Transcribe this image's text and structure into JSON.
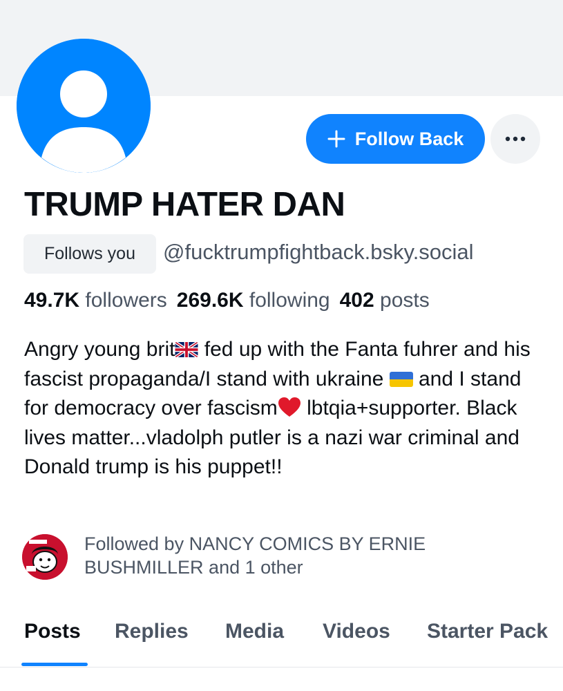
{
  "profile": {
    "display_name": "TRUMP HATER DAN",
    "follows_you_label": "Follows you",
    "handle": "@fucktrumpfightback.bsky.social",
    "avatar_icon": "default-user-avatar-icon",
    "accent_color": "#1083fe"
  },
  "actions": {
    "follow_back_label": "Follow Back",
    "follow_icon": "plus-icon",
    "more_icon": "ellipsis-icon"
  },
  "stats": {
    "followers_count": "49.7K",
    "followers_label": "followers",
    "following_count": "269.6K",
    "following_label": "following",
    "posts_count": "402",
    "posts_label": "posts"
  },
  "bio": {
    "part1": "Angry young brit",
    "flag1_icon": "uk-flag-icon",
    "part2": " fed up with the Fanta fuhrer and his fascist propaganda/I stand with ukraine ",
    "flag2_icon": "ukraine-flag-icon",
    "part3": " and I stand for democracy over fascism",
    "heart_icon": "red-heart-icon",
    "part4": " lbtqia+supporter. Black lives matter...vladolph putler is a nazi war criminal and Donald trump is his puppet!!"
  },
  "followed_by": {
    "text": "Followed by NANCY COMICS BY ERNIE BUSHMILLER and 1 other",
    "avatar_icon": "nancy-comics-avatar"
  },
  "tabs": [
    {
      "label": "Posts",
      "active": true
    },
    {
      "label": "Replies",
      "active": false
    },
    {
      "label": "Media",
      "active": false
    },
    {
      "label": "Videos",
      "active": false
    },
    {
      "label": "Starter Pack",
      "active": false
    }
  ]
}
